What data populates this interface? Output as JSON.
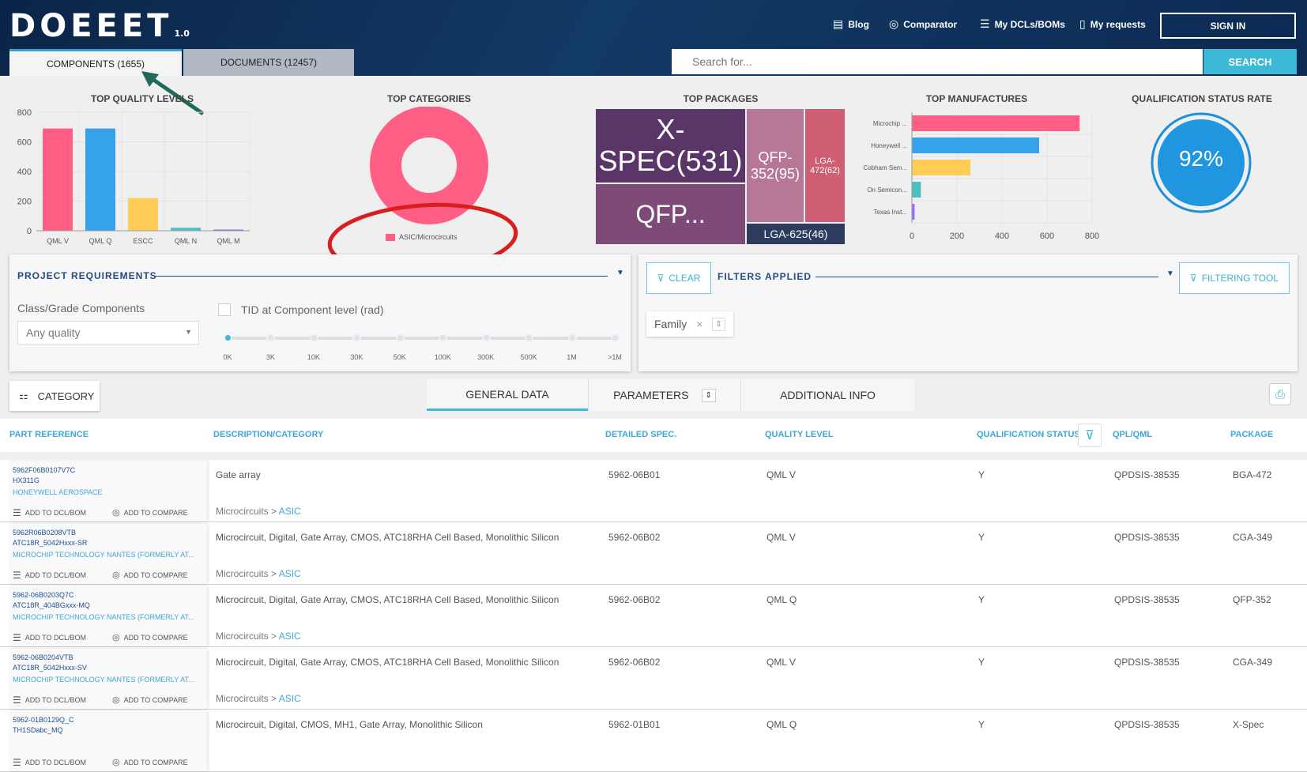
{
  "header": {
    "logo": "DOEEET",
    "version": "1.0",
    "nav": [
      {
        "label": "Blog",
        "icon": "book-icon"
      },
      {
        "label": "Comparator",
        "icon": "compare-icon"
      },
      {
        "label": "My DCLs/BOMs",
        "icon": "list-icon"
      },
      {
        "label": "My requests",
        "icon": "document-icon"
      }
    ],
    "sign_in": "SIGN IN",
    "tabs": [
      {
        "label": "COMPONENTS (1655)"
      },
      {
        "label": "DOCUMENTS (12457)"
      }
    ],
    "search_placeholder": "Search for...",
    "search_button": "SEARCH"
  },
  "charts": {
    "quality": {
      "title": "TOP QUALITY LEVELS"
    },
    "categories": {
      "title": "TOP CATEGORIES",
      "legend": "ASIC/Microcircuits"
    },
    "packages": {
      "title": "TOP PACKAGES",
      "cells": [
        "X-SPEC(531)",
        "QFP...",
        "QFP-352(95)",
        "LGA-472(62)",
        "LGA-625(46)"
      ]
    },
    "manufactures": {
      "title": "TOP MANUFACTURES"
    },
    "qualification": {
      "title": "QUALIFICATION STATUS RATE",
      "value": "92%"
    }
  },
  "chart_data": [
    {
      "type": "bar",
      "title": "TOP QUALITY LEVELS",
      "categories": [
        "QML V",
        "QML Q",
        "ESCC",
        "QML N",
        "QML M"
      ],
      "values": [
        690,
        690,
        220,
        20,
        8
      ],
      "ylim": [
        0,
        800
      ],
      "yticks": [
        0,
        200,
        400,
        600,
        800
      ],
      "colors": [
        "#ff5e85",
        "#36a2eb",
        "#ffcd56",
        "#4bc0c0",
        "#9966ff"
      ]
    },
    {
      "type": "pie",
      "title": "TOP CATEGORIES",
      "categories": [
        "ASIC/Microcircuits"
      ],
      "values": [
        100
      ],
      "colors": [
        "#ff5e85"
      ]
    },
    {
      "type": "bar",
      "title": "TOP MANUFACTURES",
      "orientation": "horizontal",
      "categories": [
        "Microchip ...",
        "Honeywell ...",
        "Cobham Sem...",
        "On Semicon...",
        "Texas Inst..."
      ],
      "values": [
        745,
        565,
        260,
        40,
        12
      ],
      "xlim": [
        0,
        800
      ],
      "xticks": [
        0,
        200,
        400,
        600,
        800
      ],
      "colors": [
        "#ff5e85",
        "#36a2eb",
        "#ffcd56",
        "#4bc0c0",
        "#9966ff"
      ]
    }
  ],
  "project": {
    "title": "PROJECT REQUIREMENTS",
    "class_label": "Class/Grade Components",
    "class_value": "Any quality",
    "tid_label": "TID at Component level (rad)",
    "ticks": [
      "0K",
      "3K",
      "10K",
      "30K",
      "50K",
      "100K",
      "300K",
      "500K",
      "1M",
      ">1M"
    ]
  },
  "filters": {
    "clear": "CLEAR",
    "title": "FILTERS APPLIED",
    "tool": "FILTERING TOOL",
    "chip": "Family"
  },
  "toolbar": {
    "category": "CATEGORY",
    "tabs": [
      "GENERAL DATA",
      "PARAMETERS",
      "ADDITIONAL INFO"
    ]
  },
  "columns": [
    "PART REFERENCE",
    "DESCRIPTION/CATEGORY",
    "DETAILED SPEC.",
    "QUALITY LEVEL",
    "QUALIFICATION STATUS",
    "QPL/QML",
    "PACKAGE"
  ],
  "actions": {
    "dcl": "ADD TO DCL/BOM",
    "compare": "ADD TO COMPARE"
  },
  "rows": [
    {
      "ref1": "5962F06B0107V7C",
      "ref2": "HX311G",
      "mfr": "HONEYWELL AEROSPACE",
      "desc": "Gate array",
      "cat1": "Microcircuits >",
      "cat2": "ASIC",
      "spec": "5962-06B01",
      "quality": "QML V",
      "status": "Y",
      "qpl": "QPDSIS-38535",
      "pkg": "BGA-472"
    },
    {
      "ref1": "5962R06B0208VTB",
      "ref2": "ATC18R_5042Hxxx-SR",
      "mfr": "MICROCHIP TECHNOLOGY NANTES (FORMERLY AT...",
      "desc": "Microcircuit, Digital, Gate Array, CMOS, ATC18RHA Cell Based, Monolithic Silicon",
      "cat1": "Microcircuits >",
      "cat2": "ASIC",
      "spec": "5962-06B02",
      "quality": "QML V",
      "status": "Y",
      "qpl": "QPDSIS-38535",
      "pkg": "CGA-349"
    },
    {
      "ref1": "5962-06B0203Q7C",
      "ref2": "ATC18R_404BGxxx-MQ",
      "mfr": "MICROCHIP TECHNOLOGY NANTES (FORMERLY AT...",
      "desc": "Microcircuit, Digital, Gate Array, CMOS, ATC18RHA Cell Based, Monolithic Silicon",
      "cat1": "Microcircuits >",
      "cat2": "ASIC",
      "spec": "5962-06B02",
      "quality": "QML Q",
      "status": "Y",
      "qpl": "QPDSIS-38535",
      "pkg": "QFP-352"
    },
    {
      "ref1": "5962-06B0204VTB",
      "ref2": "ATC18R_5042Hxxx-SV",
      "mfr": "MICROCHIP TECHNOLOGY NANTES (FORMERLY AT...",
      "desc": "Microcircuit, Digital, Gate Array, CMOS, ATC18RHA Cell Based, Monolithic Silicon",
      "cat1": "Microcircuits >",
      "cat2": "ASIC",
      "spec": "5962-06B02",
      "quality": "QML V",
      "status": "Y",
      "qpl": "QPDSIS-38535",
      "pkg": "CGA-349"
    },
    {
      "ref1": "5962-01B0129Q_C",
      "ref2": "TH1SDabc_MQ",
      "mfr": "",
      "desc": "Microcircuit, Digital, CMOS, MH1, Gate Array, Monolithic Silicon",
      "cat1": "",
      "cat2": "",
      "spec": "5962-01B01",
      "quality": "QML Q",
      "status": "Y",
      "qpl": "QPDSIS-38535",
      "pkg": "X-Spec"
    }
  ]
}
